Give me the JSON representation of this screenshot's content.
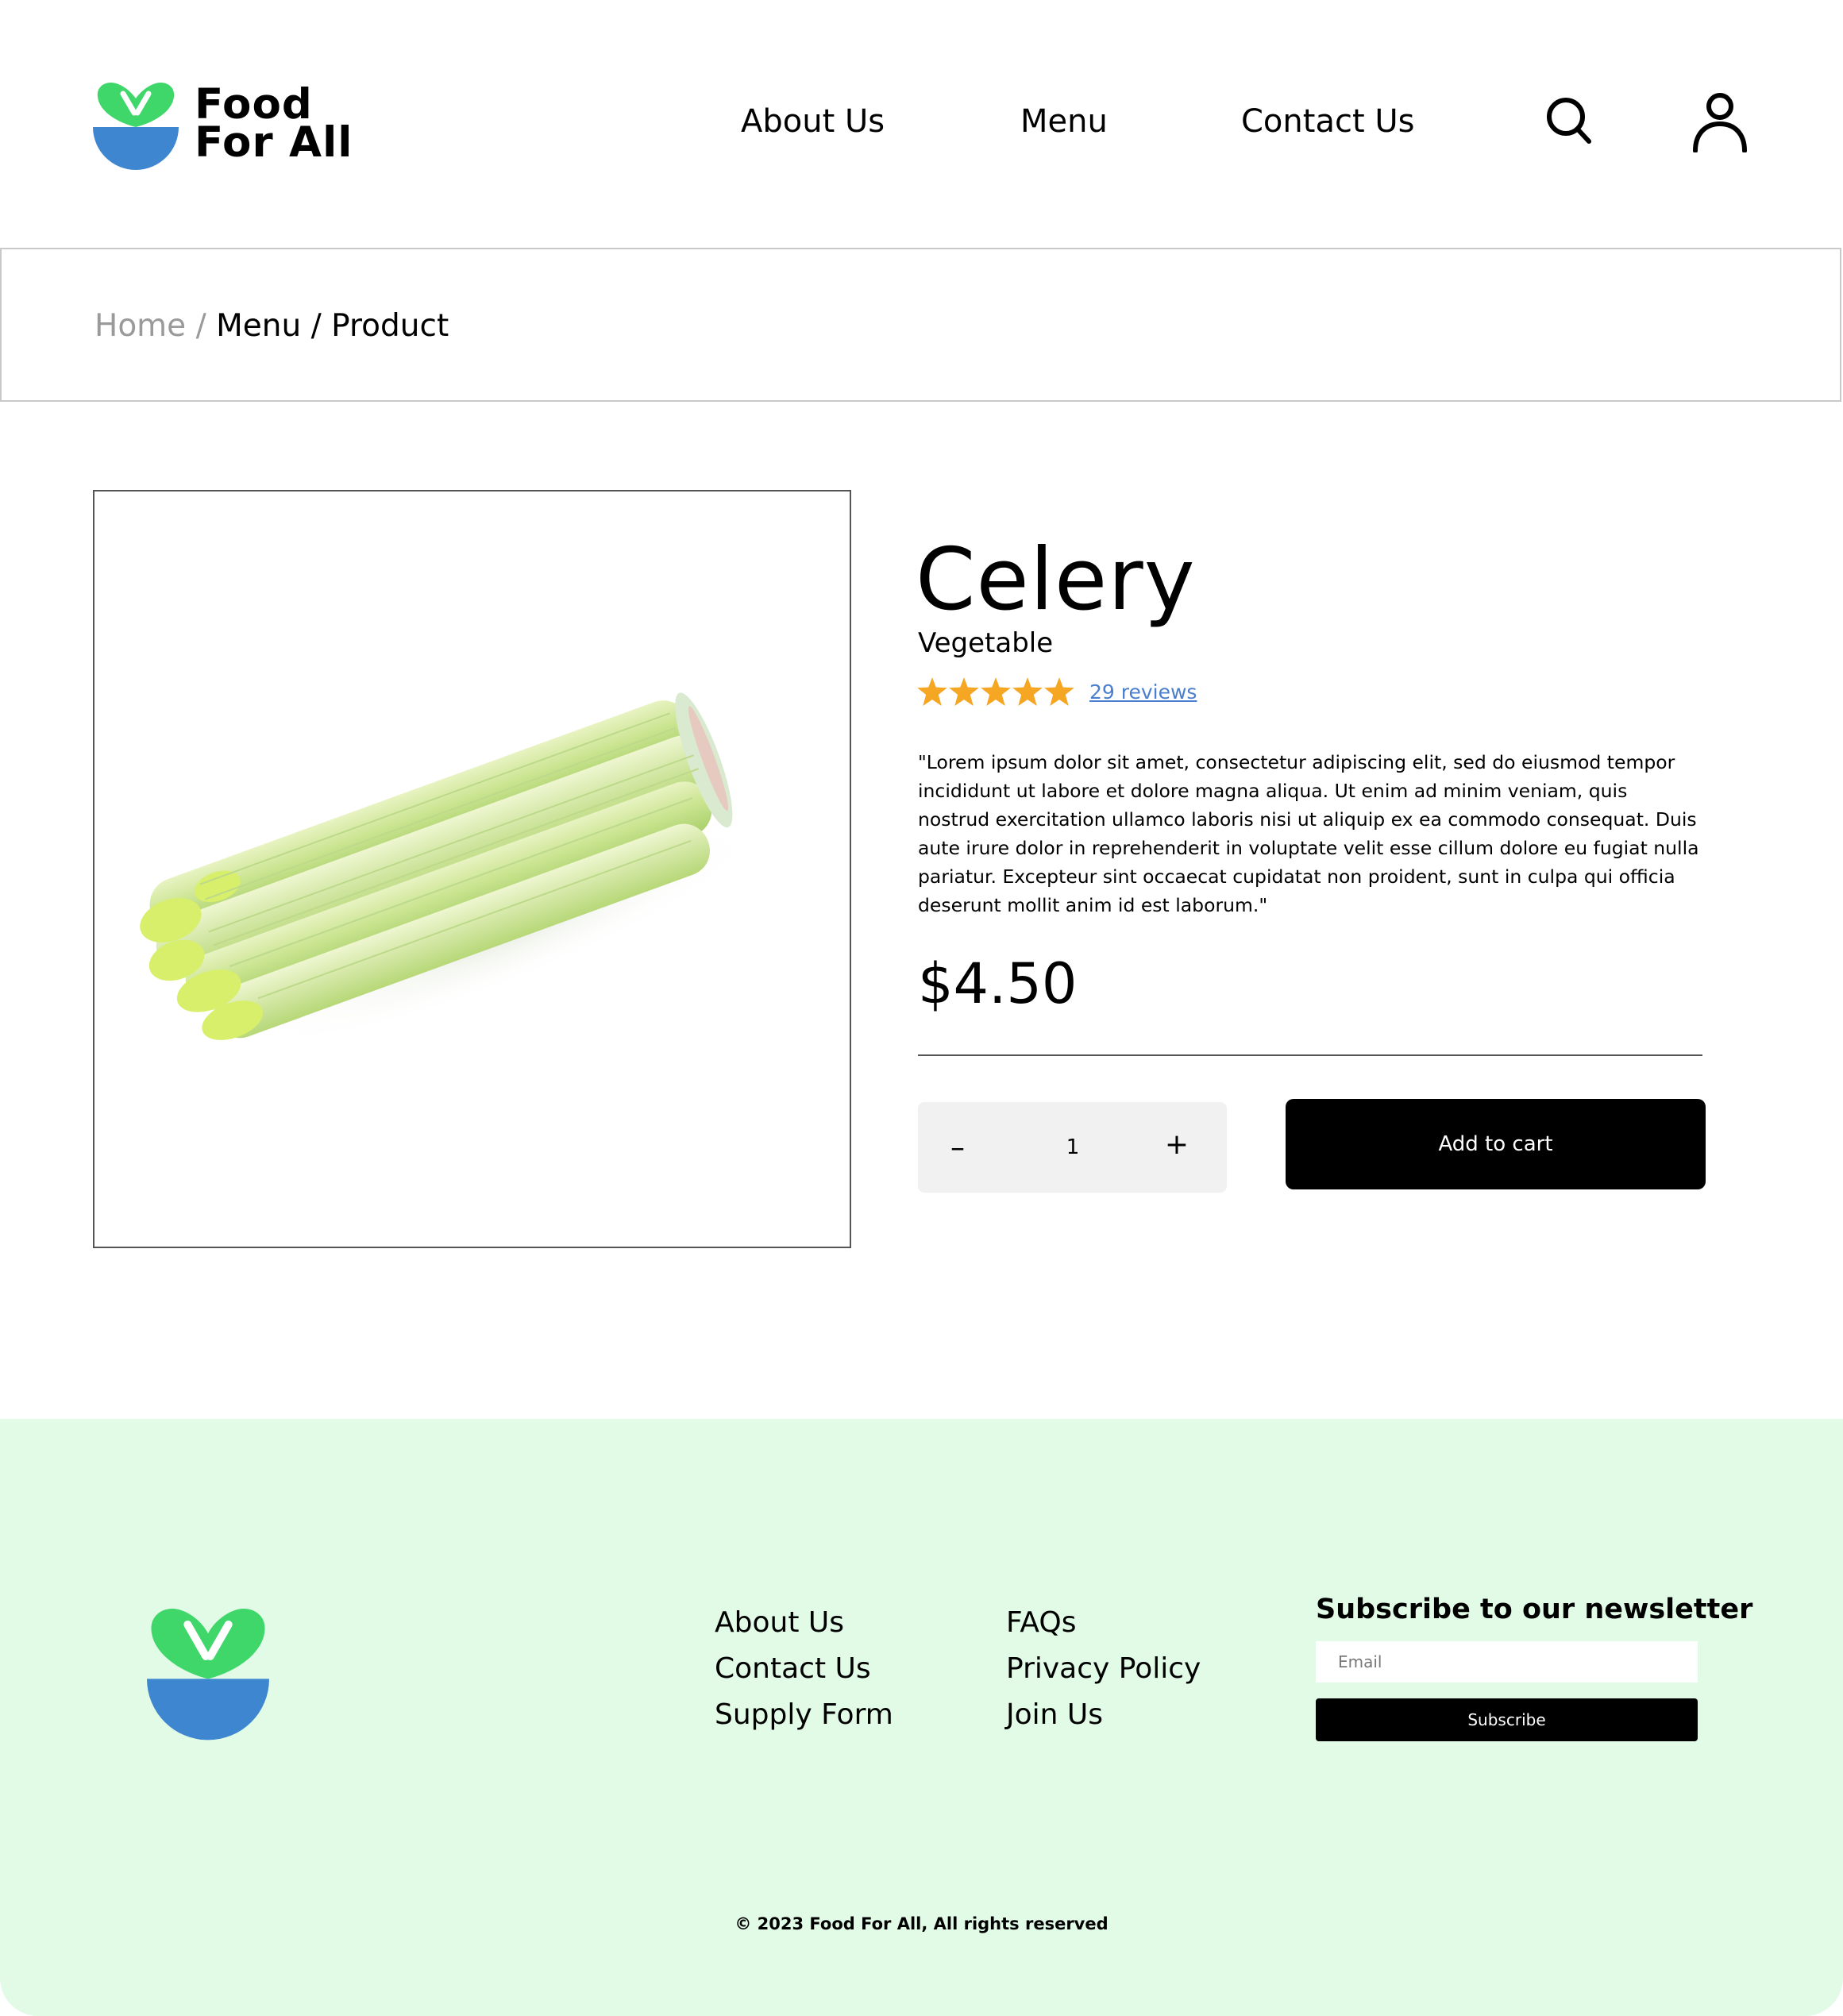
{
  "brand": {
    "name_line1": "Food",
    "name_line2": "For All",
    "logo_icon": "bowl-leaf-logo-icon",
    "colors": {
      "leaf": "#3fd76a",
      "bowl": "#3f86d1"
    }
  },
  "header": {
    "nav": [
      "About Us",
      "Menu",
      "Contact Us"
    ],
    "icons": [
      "search-icon",
      "user-icon"
    ]
  },
  "breadcrumb": {
    "home": "Home",
    "separator": "/",
    "menu": "Menu",
    "current": "Product"
  },
  "product": {
    "name": "Celery",
    "category": "Vegetable",
    "rating": 5,
    "rating_max": 5,
    "star_color": "#f5a623",
    "reviews_label": "29 reviews",
    "description": "\"Lorem ipsum dolor sit amet, consectetur adipiscing elit, sed do eiusmod tempor incididunt ut labore et dolore magna aliqua. Ut enim ad minim veniam, quis nostrud exercitation ullamco laboris nisi ut aliquip ex ea commodo consequat. Duis aute irure dolor in reprehenderit in voluptate velit esse cillum dolore eu fugiat nulla pariatur. Excepteur sint occaecat cupidatat non proident, sunt in culpa qui officia deserunt mollit anim id est laborum.\"",
    "price": "$4.50",
    "image": "celery-image"
  },
  "quantity": {
    "decrement": "–",
    "value": "1",
    "increment": "+"
  },
  "cart": {
    "add_label": "Add to cart"
  },
  "footer": {
    "background": "#e1fbe6",
    "links_col1": [
      "About Us",
      "Contact Us",
      "Supply Form"
    ],
    "links_col2": [
      "FAQs",
      "Privacy Policy",
      "Join Us"
    ],
    "newsletter": {
      "title": "Subscribe to our newsletter",
      "email_placeholder": "Email",
      "subscribe_label": "Subscribe"
    },
    "copyright": "© 2023 Food For All, All rights reserved"
  }
}
